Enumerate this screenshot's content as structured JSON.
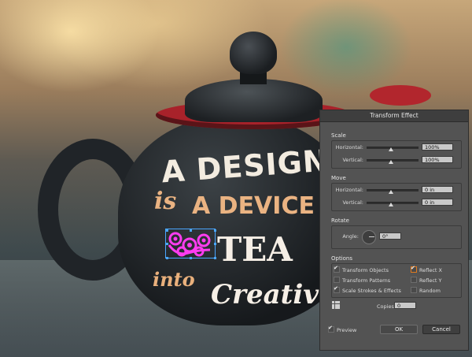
{
  "artwork": {
    "line1": "A DESIGNE",
    "line2_small": "is",
    "line2_big": "A DEVICE",
    "line3": "TEA",
    "line4_small": "into",
    "line4_big": "Creativity",
    "selection_color": "#ff3cf0"
  },
  "dialog": {
    "title": "Transform Effect",
    "scale": {
      "title": "Scale",
      "horizontal_label": "Horizontal:",
      "horizontal_value": "100%",
      "vertical_label": "Vertical:",
      "vertical_value": "100%"
    },
    "move": {
      "title": "Move",
      "horizontal_label": "Horizontal:",
      "horizontal_value": "0 in",
      "vertical_label": "Vertical:",
      "vertical_value": "0 in"
    },
    "rotate": {
      "title": "Rotate",
      "angle_label": "Angle:",
      "angle_value": "0°"
    },
    "options": {
      "title": "Options",
      "transform_objects": "Transform Objects",
      "transform_patterns": "Transform Patterns",
      "scale_strokes": "Scale Strokes & Effects",
      "reflect_x": "Reflect X",
      "reflect_y": "Reflect Y",
      "random": "Random"
    },
    "copies_label": "Copies",
    "copies_value": "0",
    "preview_label": "Preview",
    "ok_label": "OK",
    "cancel_label": "Cancel"
  }
}
